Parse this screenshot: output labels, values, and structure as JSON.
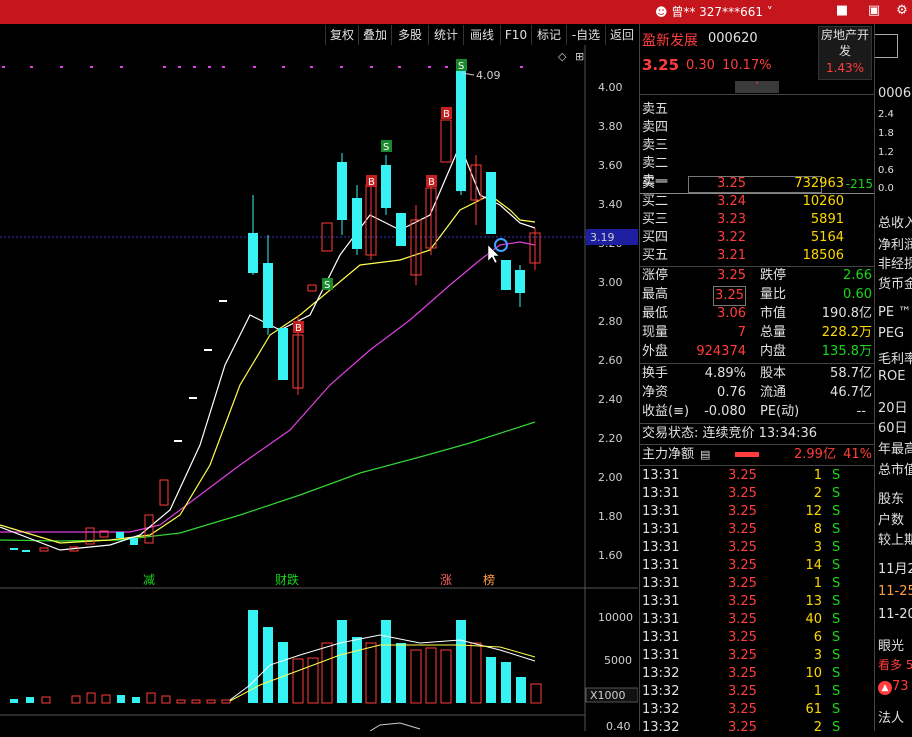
{
  "topbar": {
    "user": "曾**  327***661",
    "icons": [
      "user-icon",
      "bell-icon",
      "down-icon",
      "shield-icon",
      "gear-icon"
    ]
  },
  "toolbar": {
    "items": [
      "复权",
      "叠加",
      "多股",
      "统计",
      "画线",
      "F10",
      "标记",
      "-自选",
      "返回"
    ]
  },
  "chart": {
    "price_axis": [
      "4.00",
      "3.80",
      "3.60",
      "3.40",
      "3.20",
      "3.00",
      "2.80",
      "2.60",
      "2.40",
      "2.20",
      "2.00",
      "1.80",
      "1.60"
    ],
    "high_label": "4.09",
    "current_price_tag": "3.19",
    "markers": [
      "减",
      "财跌",
      "涨",
      "榜"
    ],
    "volume_axis": [
      "10000",
      "5000"
    ],
    "volume_unit": "X1000",
    "bottom_axis": "0.40",
    "signals": [
      "S",
      "B",
      "S",
      "B",
      "B",
      "B",
      "S"
    ]
  },
  "quote": {
    "name": "盈新发展",
    "code": "000620",
    "sector": "房地产开发",
    "sector_pct": "1.43%",
    "price": "3.25",
    "change": "0.30",
    "change_pct": "10.17%",
    "asks": [
      {
        "label": "卖五",
        "price": "",
        "vol": ""
      },
      {
        "label": "卖四",
        "price": "",
        "vol": ""
      },
      {
        "label": "卖三",
        "price": "",
        "vol": ""
      },
      {
        "label": "卖二",
        "price": "",
        "vol": ""
      },
      {
        "label": "卖一",
        "price": "",
        "vol": ""
      }
    ],
    "bids": [
      {
        "label": "买一",
        "price": "3.25",
        "vol": "732963",
        "diff": "-215"
      },
      {
        "label": "买二",
        "price": "3.24",
        "vol": "10260"
      },
      {
        "label": "买三",
        "price": "3.23",
        "vol": "5891"
      },
      {
        "label": "买四",
        "price": "3.22",
        "vol": "5164"
      },
      {
        "label": "买五",
        "price": "3.21",
        "vol": "18506"
      }
    ],
    "stats": [
      {
        "l1": "涨停",
        "v1": "3.25",
        "l2": "跌停",
        "v2": "2.66"
      },
      {
        "l1": "最高",
        "v1": "3.25",
        "l2": "量比",
        "v2": "0.60"
      },
      {
        "l1": "最低",
        "v1": "3.06",
        "l2": "市值",
        "v2": "190.8亿"
      },
      {
        "l1": "现量",
        "v1": "7",
        "l2": "总量",
        "v2": "228.2万"
      },
      {
        "l1": "外盘",
        "v1": "924374",
        "l2": "内盘",
        "v2": "135.8万"
      }
    ],
    "stats2": [
      {
        "l1": "换手",
        "v1": "4.89%",
        "l2": "股本",
        "v2": "58.7亿"
      },
      {
        "l1": "净资",
        "v1": "0.76",
        "l2": "流通",
        "v2": "46.7亿"
      },
      {
        "l1": "收益(≡)",
        "v1": "-0.080",
        "l2": "PE(动)",
        "v2": "--"
      }
    ],
    "status": "交易状态: 连续竞价 13:34:36",
    "main_flow_label": "主力净额",
    "main_flow_value": "2.99亿",
    "main_flow_pct": "41%",
    "ticks": [
      {
        "t": "13:31",
        "p": "3.25",
        "v": "1",
        "s": "S"
      },
      {
        "t": "13:31",
        "p": "3.25",
        "v": "2",
        "s": "S"
      },
      {
        "t": "13:31",
        "p": "3.25",
        "v": "12",
        "s": "S"
      },
      {
        "t": "13:31",
        "p": "3.25",
        "v": "8",
        "s": "S"
      },
      {
        "t": "13:31",
        "p": "3.25",
        "v": "3",
        "s": "S"
      },
      {
        "t": "13:31",
        "p": "3.25",
        "v": "14",
        "s": "S"
      },
      {
        "t": "13:31",
        "p": "3.25",
        "v": "1",
        "s": "S"
      },
      {
        "t": "13:31",
        "p": "3.25",
        "v": "13",
        "s": "S"
      },
      {
        "t": "13:31",
        "p": "3.25",
        "v": "40",
        "s": "S"
      },
      {
        "t": "13:31",
        "p": "3.25",
        "v": "6",
        "s": "S"
      },
      {
        "t": "13:31",
        "p": "3.25",
        "v": "3",
        "s": "S"
      },
      {
        "t": "13:32",
        "p": "3.25",
        "v": "10",
        "s": "S"
      },
      {
        "t": "13:32",
        "p": "3.25",
        "v": "1",
        "s": "S"
      },
      {
        "t": "13:32",
        "p": "3.25",
        "v": "61",
        "s": "S"
      },
      {
        "t": "13:32",
        "p": "3.25",
        "v": "2",
        "s": "S"
      }
    ]
  },
  "right_panel": {
    "code_prefix": "0006",
    "nums": [
      "2.4",
      "1.8",
      "1.2",
      "0.6",
      "0.0"
    ],
    "labels": [
      "总收入",
      "净利润",
      "非经损",
      "货币金",
      "PE ™",
      "PEG",
      "毛利率",
      "ROE",
      "20日",
      "60日",
      "年最高",
      "总市值",
      "股东",
      "户数",
      "较上期",
      "11月2",
      "11-25",
      "11-20",
      "眼光",
      "看多 5",
      "73",
      "法人"
    ]
  },
  "colors": {
    "up": "#ff3d3d",
    "down": "#36f2f2",
    "ma5": "#ffffff",
    "ma10": "#ffff4d",
    "ma20": "#e040e0",
    "ma60": "#33d633",
    "topbar": "#c5161d"
  }
}
